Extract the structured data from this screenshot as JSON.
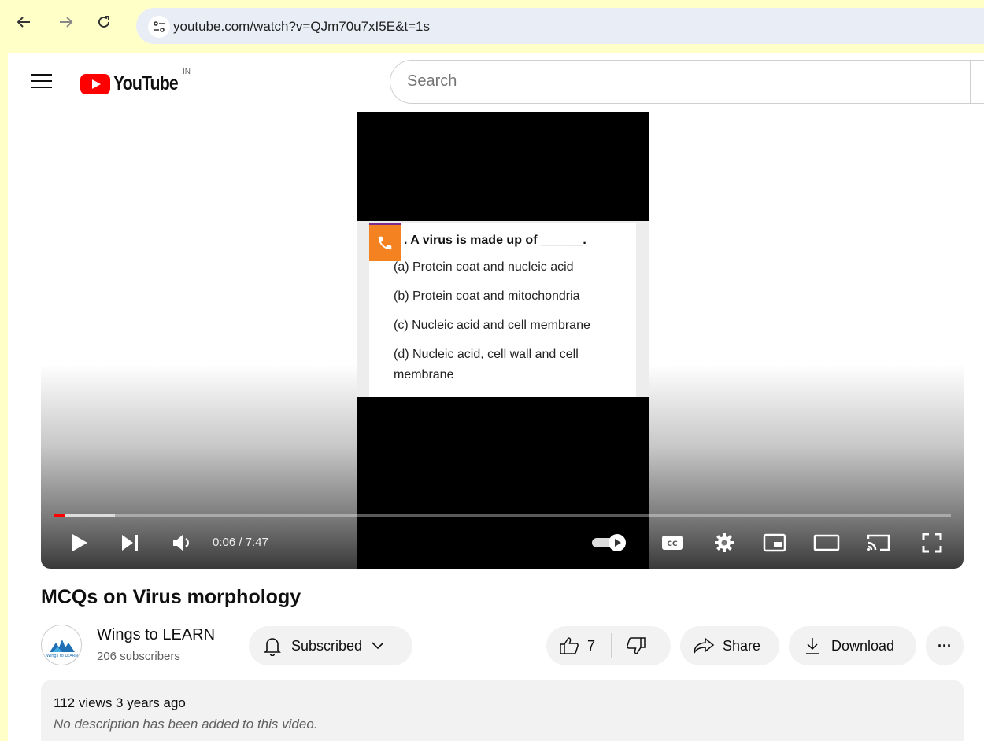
{
  "browser": {
    "url": "youtube.com/watch?v=QJm70u7xI5E&t=1s",
    "back_icon": "arrow-left",
    "forward_icon": "arrow-right",
    "reload_icon": "reload",
    "site_info_icon": "tune"
  },
  "header": {
    "logo_text": "YouTube",
    "region": "IN",
    "search_placeholder": "Search"
  },
  "video_slide": {
    "question": ". A virus is made up of ______.",
    "options": [
      "(a) Protein coat and nucleic acid",
      "(b) Protein coat and mitochondria",
      "(c) Nucleic acid and cell membrane",
      "(d) Nucleic acid, cell wall and cell membrane"
    ]
  },
  "player": {
    "time": "0:06 / 7:47",
    "progress_fraction": 0.013,
    "buffer_fraction": 0.068,
    "cc_label": "CC"
  },
  "video": {
    "title": "MCQs on Virus morphology"
  },
  "channel": {
    "name": "Wings to LEARN",
    "subscribers": "206 subscribers",
    "avatar_text": "Wings to LEARN"
  },
  "actions": {
    "subscribed_label": "Subscribed",
    "like_count": "7",
    "share_label": "Share",
    "download_label": "Download",
    "more_label": "···"
  },
  "description": {
    "meta": "112 views  3 years ago",
    "text": "No description has been added to this video."
  },
  "colors": {
    "brand_red": "#ff0000",
    "highlight_bg": "#ffffc8",
    "phone_badge": "#f58220"
  }
}
